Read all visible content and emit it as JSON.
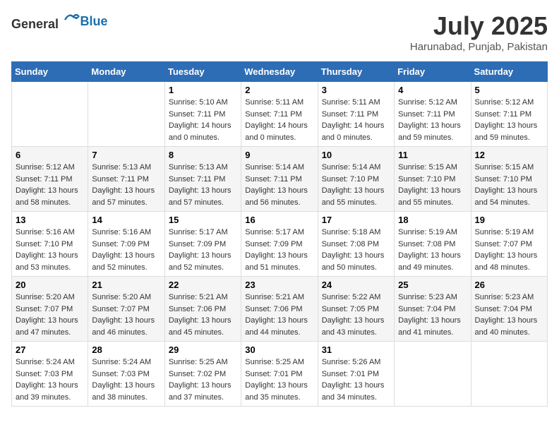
{
  "header": {
    "logo_general": "General",
    "logo_blue": "Blue",
    "title": "July 2025",
    "location": "Harunabad, Punjab, Pakistan"
  },
  "days_of_week": [
    "Sunday",
    "Monday",
    "Tuesday",
    "Wednesday",
    "Thursday",
    "Friday",
    "Saturday"
  ],
  "weeks": [
    [
      {
        "day": "",
        "details": ""
      },
      {
        "day": "",
        "details": ""
      },
      {
        "day": "1",
        "details": "Sunrise: 5:10 AM\nSunset: 7:11 PM\nDaylight: 14 hours and 0 minutes."
      },
      {
        "day": "2",
        "details": "Sunrise: 5:11 AM\nSunset: 7:11 PM\nDaylight: 14 hours and 0 minutes."
      },
      {
        "day": "3",
        "details": "Sunrise: 5:11 AM\nSunset: 7:11 PM\nDaylight: 14 hours and 0 minutes."
      },
      {
        "day": "4",
        "details": "Sunrise: 5:12 AM\nSunset: 7:11 PM\nDaylight: 13 hours and 59 minutes."
      },
      {
        "day": "5",
        "details": "Sunrise: 5:12 AM\nSunset: 7:11 PM\nDaylight: 13 hours and 59 minutes."
      }
    ],
    [
      {
        "day": "6",
        "details": "Sunrise: 5:12 AM\nSunset: 7:11 PM\nDaylight: 13 hours and 58 minutes."
      },
      {
        "day": "7",
        "details": "Sunrise: 5:13 AM\nSunset: 7:11 PM\nDaylight: 13 hours and 57 minutes."
      },
      {
        "day": "8",
        "details": "Sunrise: 5:13 AM\nSunset: 7:11 PM\nDaylight: 13 hours and 57 minutes."
      },
      {
        "day": "9",
        "details": "Sunrise: 5:14 AM\nSunset: 7:11 PM\nDaylight: 13 hours and 56 minutes."
      },
      {
        "day": "10",
        "details": "Sunrise: 5:14 AM\nSunset: 7:10 PM\nDaylight: 13 hours and 55 minutes."
      },
      {
        "day": "11",
        "details": "Sunrise: 5:15 AM\nSunset: 7:10 PM\nDaylight: 13 hours and 55 minutes."
      },
      {
        "day": "12",
        "details": "Sunrise: 5:15 AM\nSunset: 7:10 PM\nDaylight: 13 hours and 54 minutes."
      }
    ],
    [
      {
        "day": "13",
        "details": "Sunrise: 5:16 AM\nSunset: 7:10 PM\nDaylight: 13 hours and 53 minutes."
      },
      {
        "day": "14",
        "details": "Sunrise: 5:16 AM\nSunset: 7:09 PM\nDaylight: 13 hours and 52 minutes."
      },
      {
        "day": "15",
        "details": "Sunrise: 5:17 AM\nSunset: 7:09 PM\nDaylight: 13 hours and 52 minutes."
      },
      {
        "day": "16",
        "details": "Sunrise: 5:17 AM\nSunset: 7:09 PM\nDaylight: 13 hours and 51 minutes."
      },
      {
        "day": "17",
        "details": "Sunrise: 5:18 AM\nSunset: 7:08 PM\nDaylight: 13 hours and 50 minutes."
      },
      {
        "day": "18",
        "details": "Sunrise: 5:19 AM\nSunset: 7:08 PM\nDaylight: 13 hours and 49 minutes."
      },
      {
        "day": "19",
        "details": "Sunrise: 5:19 AM\nSunset: 7:07 PM\nDaylight: 13 hours and 48 minutes."
      }
    ],
    [
      {
        "day": "20",
        "details": "Sunrise: 5:20 AM\nSunset: 7:07 PM\nDaylight: 13 hours and 47 minutes."
      },
      {
        "day": "21",
        "details": "Sunrise: 5:20 AM\nSunset: 7:07 PM\nDaylight: 13 hours and 46 minutes."
      },
      {
        "day": "22",
        "details": "Sunrise: 5:21 AM\nSunset: 7:06 PM\nDaylight: 13 hours and 45 minutes."
      },
      {
        "day": "23",
        "details": "Sunrise: 5:21 AM\nSunset: 7:06 PM\nDaylight: 13 hours and 44 minutes."
      },
      {
        "day": "24",
        "details": "Sunrise: 5:22 AM\nSunset: 7:05 PM\nDaylight: 13 hours and 43 minutes."
      },
      {
        "day": "25",
        "details": "Sunrise: 5:23 AM\nSunset: 7:04 PM\nDaylight: 13 hours and 41 minutes."
      },
      {
        "day": "26",
        "details": "Sunrise: 5:23 AM\nSunset: 7:04 PM\nDaylight: 13 hours and 40 minutes."
      }
    ],
    [
      {
        "day": "27",
        "details": "Sunrise: 5:24 AM\nSunset: 7:03 PM\nDaylight: 13 hours and 39 minutes."
      },
      {
        "day": "28",
        "details": "Sunrise: 5:24 AM\nSunset: 7:03 PM\nDaylight: 13 hours and 38 minutes."
      },
      {
        "day": "29",
        "details": "Sunrise: 5:25 AM\nSunset: 7:02 PM\nDaylight: 13 hours and 37 minutes."
      },
      {
        "day": "30",
        "details": "Sunrise: 5:25 AM\nSunset: 7:01 PM\nDaylight: 13 hours and 35 minutes."
      },
      {
        "day": "31",
        "details": "Sunrise: 5:26 AM\nSunset: 7:01 PM\nDaylight: 13 hours and 34 minutes."
      },
      {
        "day": "",
        "details": ""
      },
      {
        "day": "",
        "details": ""
      }
    ]
  ]
}
